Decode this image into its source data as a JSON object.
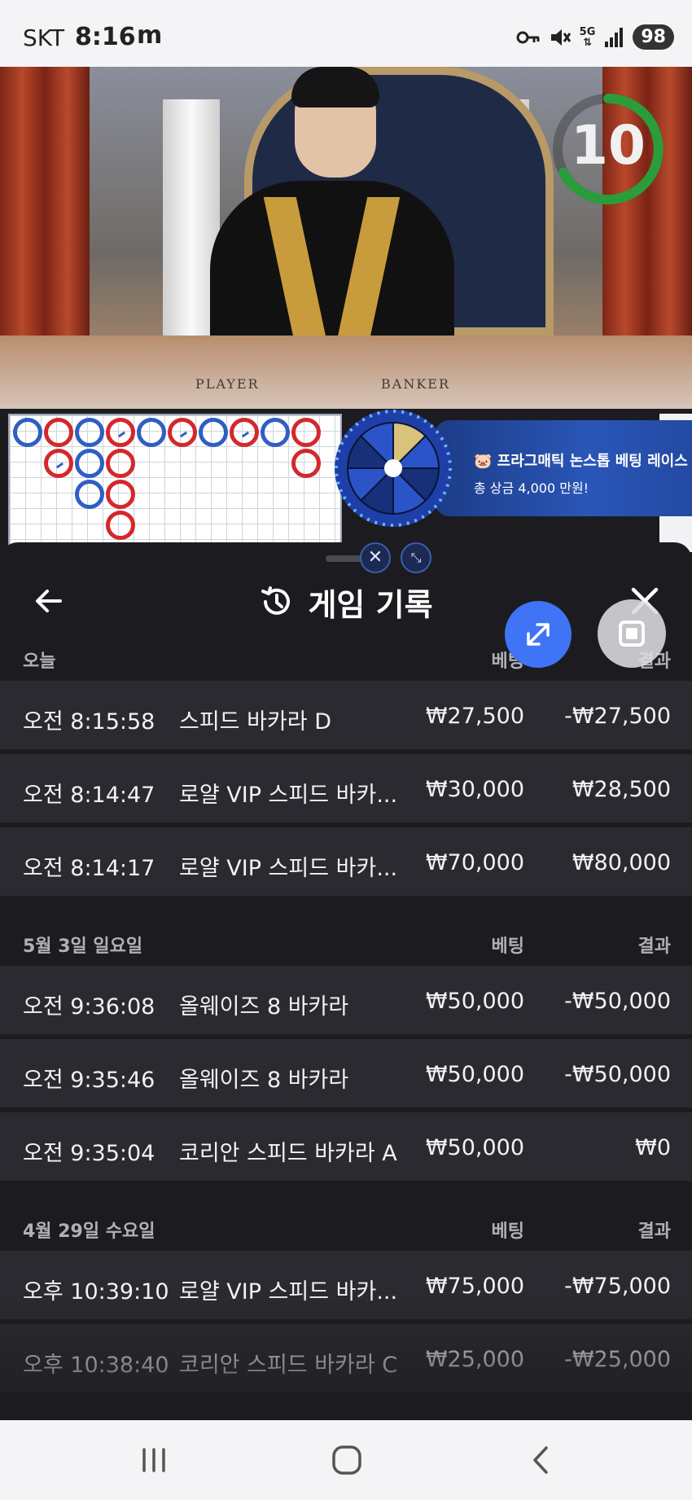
{
  "status_bar": {
    "carrier": "SKT",
    "time": "8:16",
    "app_indicator": "m",
    "network": "5G",
    "battery": "98",
    "icons": [
      "key-icon",
      "mute-icon",
      "5g-data-icon",
      "signal-icon"
    ]
  },
  "video": {
    "table_labels": {
      "player": "PLAYER",
      "banker": "BANKER"
    },
    "timer": "10"
  },
  "promo": {
    "title": "🐷 프라그매틱 논스톱 베팅 레이스",
    "subtitle": "총 상금 4,000 만원!"
  },
  "panel": {
    "title": "게임 기록",
    "sections": [
      {
        "date": "오늘",
        "bet_header": "베팅",
        "result_header": "결과",
        "rows": [
          {
            "time": "오전 8:15:58",
            "game": "스피드 바카라 D",
            "bet": "₩27,500",
            "result": "-₩27,500"
          },
          {
            "time": "오전 8:14:47",
            "game": "로얄 VIP 스피드 바카...",
            "bet": "₩30,000",
            "result": "₩28,500"
          },
          {
            "time": "오전 8:14:17",
            "game": "로얄 VIP 스피드 바카...",
            "bet": "₩70,000",
            "result": "₩80,000"
          }
        ]
      },
      {
        "date": "5월 3일 일요일",
        "bet_header": "베팅",
        "result_header": "결과",
        "rows": [
          {
            "time": "오전 9:36:08",
            "game": "올웨이즈 8 바카라",
            "bet": "₩50,000",
            "result": "-₩50,000"
          },
          {
            "time": "오전 9:35:46",
            "game": "올웨이즈 8 바카라",
            "bet": "₩50,000",
            "result": "-₩50,000"
          },
          {
            "time": "오전 9:35:04",
            "game": "코리안 스피드 바카라 A",
            "bet": "₩50,000",
            "result": "₩0"
          }
        ]
      },
      {
        "date": "4월 29일 수요일",
        "bet_header": "베팅",
        "result_header": "결과",
        "rows": [
          {
            "time": "오후 10:39:10",
            "game": "로얄 VIP 스피드 바카...",
            "bet": "₩75,000",
            "result": "-₩75,000"
          },
          {
            "time": "오후 10:38:40",
            "game": "코리안 스피드 바카라 C",
            "bet": "₩25,000",
            "result": "-₩25,000"
          }
        ]
      }
    ]
  },
  "colors": {
    "accent": "#3f74f6",
    "panel_bg": "#1c1c20",
    "row_bg": "#2a2a30",
    "banker_red": "#d3282c",
    "player_blue": "#2f5ec4",
    "timer_green": "#2a9d3a"
  }
}
